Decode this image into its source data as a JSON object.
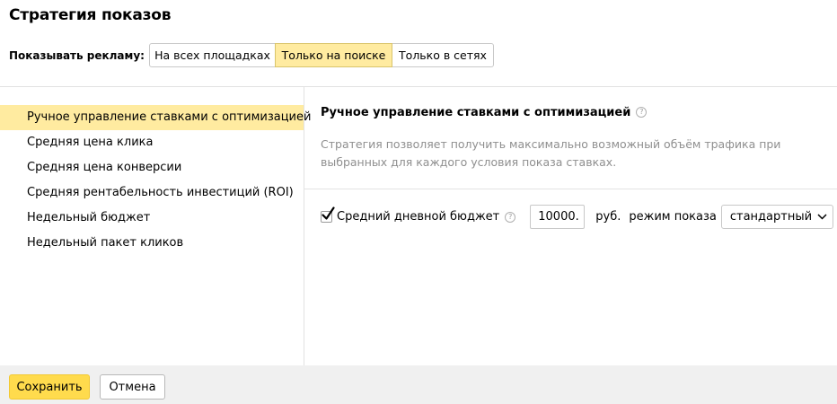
{
  "page_title": "Стратегия показов",
  "show_ads": {
    "label": "Показывать рекламу:",
    "options": [
      "На всех площадках",
      "Только на поиске",
      "Только в сетях"
    ],
    "selected": "Только на поиске"
  },
  "strategies": [
    "Ручное управление ставками с оптимизацией",
    "Средняя цена клика",
    "Средняя цена конверсии",
    "Средняя рентабельность инвестиций (ROI)",
    "Недельный бюджет",
    "Недельный пакет кликов"
  ],
  "selected_strategy": "Ручное управление ставками с оптимизацией",
  "detail": {
    "title": "Ручное управление ставками с оптимизацией",
    "help": "?",
    "description": "Стратегия позволяет получить максимально возможный объём трафика при выбранных для каждого условия показа ставках."
  },
  "budget": {
    "checked": true,
    "label": "Средний дневной бюджет",
    "help": "?",
    "value": "10000.",
    "currency": "руб.",
    "mode_label": "режим показа",
    "mode_value": "стандартный"
  },
  "footer": {
    "save_label": "Сохранить",
    "cancel_label": "Отмена"
  },
  "colors": {
    "highlight": "#ffeba0",
    "primary_button": "#ffdb4d",
    "footer_bg": "#f0f0f0",
    "muted_text": "#8f8f8f"
  }
}
